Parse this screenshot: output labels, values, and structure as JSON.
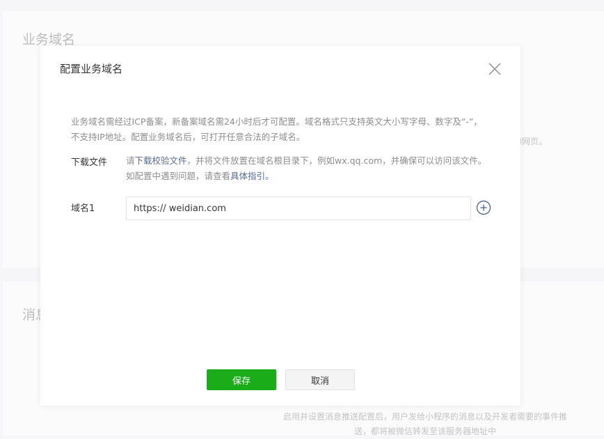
{
  "background": {
    "section1_title": "业务域名",
    "section1_fragment": "的网页。",
    "section2_title": "消息",
    "section2_text_line1": "启用并设置消息推送配置后，用户发给小程序的消息以及开发者需要的事件推",
    "section2_text_line2": "送，都将被微信转发至该服务器地址中"
  },
  "modal": {
    "title": "配置业务域名",
    "description": "业务域名需经过ICP备案，新备案域名需24小时后才可配置。域名格式只支持英文大小写字母、数字及“-”，不支持IP地址。配置业务域名后，可打开任意合法的子域名。",
    "download": {
      "label": "下载文件",
      "text_before": "请",
      "link_download": "下载校验文件",
      "text_middle": "，并将文件放置在域名根目录下，例如wx.qq.com，并确保可以访问该文件。如配置中遇到问题，请查看",
      "link_guide": "具体指引",
      "text_after": "。"
    },
    "domain": {
      "label": "域名1",
      "value": "https:// weidian.com",
      "add_icon": "plus-circle-icon"
    },
    "close_icon": "close-icon",
    "buttons": {
      "save": "保存",
      "cancel": "取消"
    }
  },
  "colors": {
    "primary_green": "#1aad19",
    "link_blue": "#576b95",
    "text_gray": "#8d8d8d"
  }
}
